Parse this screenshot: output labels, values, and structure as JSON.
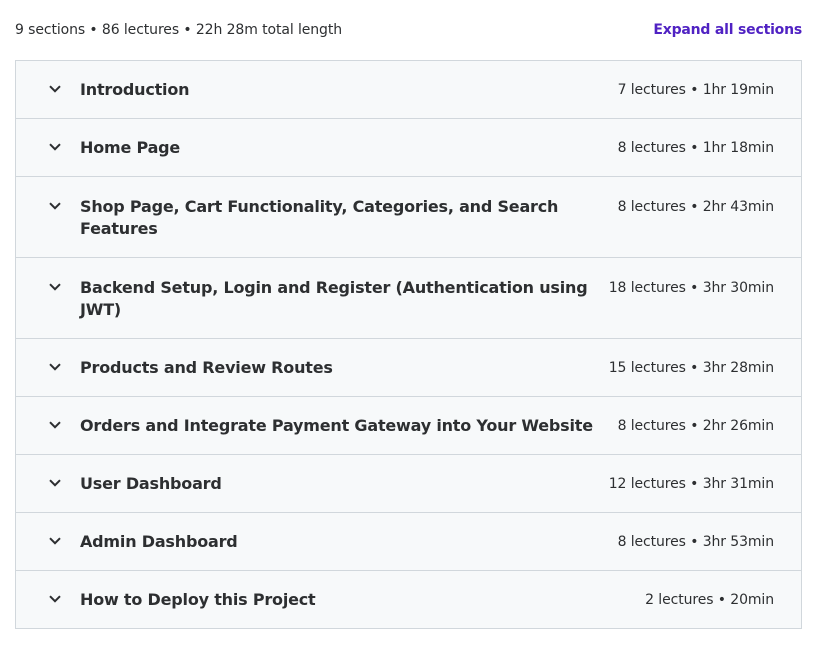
{
  "header": {
    "summary": "9 sections • 86 lectures • 22h 28m total length",
    "expand_label": "Expand all sections"
  },
  "sections": [
    {
      "title": "Introduction",
      "meta": "7 lectures • 1hr 19min"
    },
    {
      "title": "Home Page",
      "meta": "8 lectures • 1hr 18min"
    },
    {
      "title": "Shop Page, Cart Functionality, Categories, and Search Features",
      "meta": "8 lectures • 2hr 43min"
    },
    {
      "title": "Backend Setup, Login and Register (Authentication using JWT)",
      "meta": "18 lectures • 3hr 30min"
    },
    {
      "title": "Products and Review Routes",
      "meta": "15 lectures • 3hr 28min"
    },
    {
      "title": "Orders and Integrate Payment Gateway into Your Website",
      "meta": "8 lectures • 2hr 26min"
    },
    {
      "title": "User Dashboard",
      "meta": "12 lectures • 3hr 31min"
    },
    {
      "title": "Admin Dashboard",
      "meta": "8 lectures • 3hr 53min"
    },
    {
      "title": "How to Deploy this Project",
      "meta": "2 lectures • 20min"
    }
  ],
  "icons": {
    "section_toggle": "chevron-down-icon"
  },
  "colors": {
    "accent": "#5022c3",
    "section_bg": "#f7f9fa",
    "border": "#d1d7dc",
    "text": "#2d2f31"
  }
}
